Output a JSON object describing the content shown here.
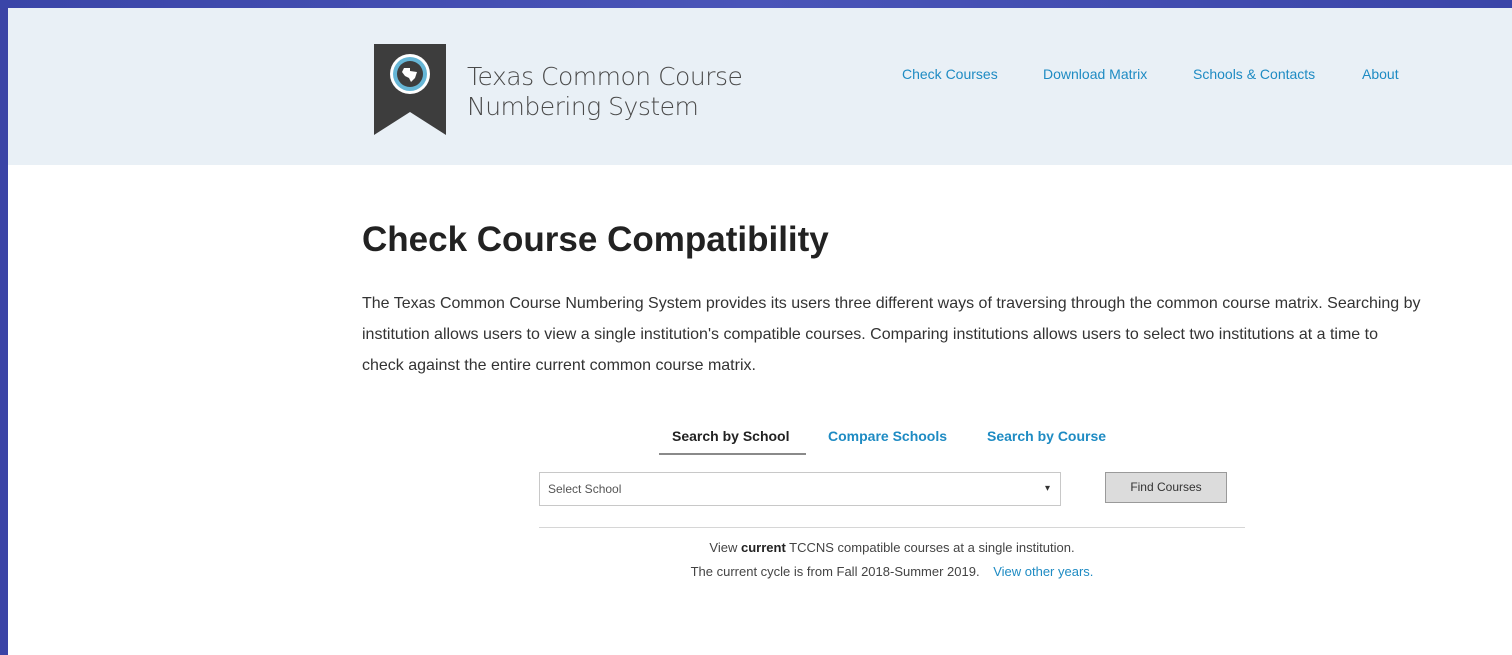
{
  "header": {
    "brand_line1": "Texas Common Course",
    "brand_line2": "Numbering System",
    "logo_icon": "texas-map-badge-icon",
    "nav": [
      {
        "label": "Check Courses"
      },
      {
        "label": "Download Matrix"
      },
      {
        "label": "Schools & Contacts"
      },
      {
        "label": "About"
      }
    ]
  },
  "main": {
    "title": "Check Course Compatibility",
    "intro": "The Texas Common Course Numbering System provides its users three different ways of traversing through the common course matrix. Searching by institution allows users to view a single institution's compatible courses. Comparing institutions allows users to select two institutions at a time to check against the entire current common course matrix.",
    "tabs": [
      {
        "label": "Search by School",
        "active": true
      },
      {
        "label": "Compare Schools",
        "active": false
      },
      {
        "label": "Search by Course",
        "active": false
      }
    ],
    "select_value": "Select School",
    "find_button": "Find Courses",
    "note_line1_pre": "View",
    "note_line1_bold": "current",
    "note_line1_post": "TCCNS compatible courses at a single institution.",
    "note_line2": "The current cycle is from Fall 2018-Summer 2019.",
    "note_link": "View other years."
  },
  "colors": {
    "accent": "#1e8bc3",
    "header_bg": "#e9f0f6",
    "frame": "#3b44a6"
  }
}
